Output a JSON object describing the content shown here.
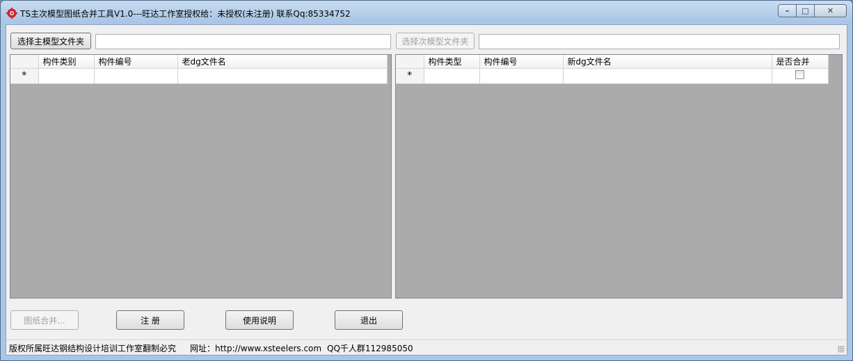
{
  "window": {
    "title": "TS主次模型图纸合并工具V1.0---旺达工作室授权给：未授权(未注册) 联系Qq:85334752",
    "minimize_glyph": "–",
    "maximize_glyph": "□",
    "close_glyph": "✕"
  },
  "main_folder": {
    "button_label": "选择主模型文件夹",
    "path_value": ""
  },
  "sub_folder": {
    "button_label": "选择次模型文件夹",
    "path_value": ""
  },
  "left_grid": {
    "columns": [
      "构件类别",
      "构件编号",
      "老dg文件名"
    ],
    "new_row_marker": "*"
  },
  "right_grid": {
    "columns": [
      "构件类型",
      "构件编号",
      "新dg文件名",
      "是否合并"
    ],
    "new_row_marker": "*"
  },
  "actions": {
    "merge_label": "图纸合并...",
    "register_label": "注 册",
    "help_label": "使用说明",
    "exit_label": "退出"
  },
  "status": {
    "copyright": "版权所属旺达钢结构设计培训工作室翻制必究",
    "website": "网址：http://www.xsteelers.com",
    "qq_group": "QQ千人群112985050"
  },
  "colors": {
    "grid_background": "#ababab",
    "title_bar": "#a9c6e6",
    "icon_red": "#d21f2b"
  }
}
